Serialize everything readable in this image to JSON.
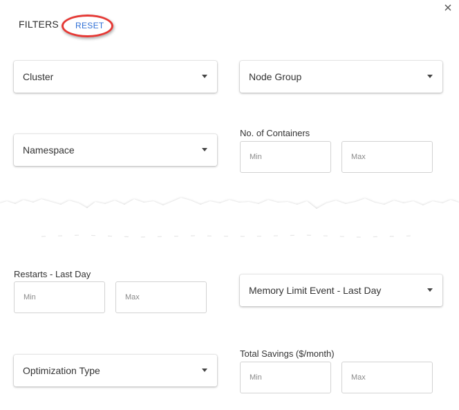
{
  "header": {
    "title": "FILTERS",
    "reset_label": "RESET"
  },
  "filters": {
    "cluster": {
      "label": "Cluster"
    },
    "node_group": {
      "label": "Node Group"
    },
    "namespace": {
      "label": "Namespace"
    },
    "containers": {
      "label": "No. of Containers",
      "min_placeholder": "Min",
      "max_placeholder": "Max"
    },
    "restarts": {
      "label": "Restarts - Last Day",
      "min_placeholder": "Min",
      "max_placeholder": "Max"
    },
    "memory_limit_event": {
      "label": "Memory Limit Event - Last Day"
    },
    "optimization_type": {
      "label": "Optimization Type"
    },
    "savings": {
      "label": "Total Savings ($/month)",
      "min_placeholder": "Min",
      "max_placeholder": "Max"
    }
  },
  "colors": {
    "reset_link": "#2f6fd6",
    "highlight_ring": "#e53935"
  },
  "icons": {
    "close": "close-icon",
    "dropdown": "chevron-down-icon"
  }
}
